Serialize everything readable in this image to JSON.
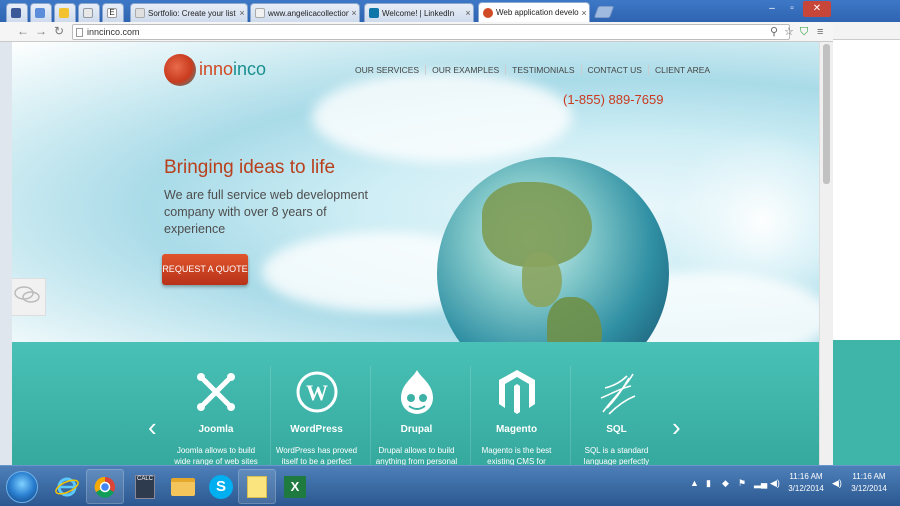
{
  "browser": {
    "tabs": [
      {
        "label": "",
        "favicon_color": "#3b5998"
      },
      {
        "label": "",
        "favicon_color": "#5b8ddb"
      },
      {
        "label": "",
        "favicon_color": "#f2c230"
      },
      {
        "label": "",
        "favicon_color": "#8f9aa5"
      },
      {
        "label": "Sortfolio: Create your list",
        "favicon_color": "#e0e0e0"
      },
      {
        "label": "www.angelicacollection.c",
        "favicon_color": "#cfcfcf"
      },
      {
        "label": "Welcome! | LinkedIn",
        "favicon_color": "#0e76a8"
      },
      {
        "label": "Web application develop",
        "favicon_color": "#d04a24"
      }
    ],
    "address": "inncinco.com"
  },
  "site": {
    "logo_text_a": "inno",
    "logo_text_b": "inco",
    "nav": [
      "OUR SERVICES",
      "OUR EXAMPLES",
      "TESTIMONIALS",
      "CONTACT US",
      "CLIENT AREA"
    ],
    "phone": "(1-855) 889-7659",
    "tagline": "Bringing ideas to life",
    "subtagline": "We are full service web development company with over 8 years of experience",
    "cta": "REQUEST A QUOTE",
    "features": [
      {
        "name": "Joomla",
        "desc": "Joomla allows to build wide range of web sites",
        "icon": "joomla-icon"
      },
      {
        "name": "WordPress",
        "desc": "WordPress has proved itself to be a perfect",
        "icon": "wordpress-icon"
      },
      {
        "name": "Drupal",
        "desc": "Drupal allows to build anything from personal",
        "icon": "drupal-icon"
      },
      {
        "name": "Magento",
        "desc": "Magento is the best existing CMS for",
        "icon": "magento-icon"
      },
      {
        "name": "SQL",
        "desc": "SQL is a standard language perfectly",
        "icon": "sql-server-icon"
      }
    ]
  },
  "taskbar": {
    "clock_time": "11:16 AM",
    "clock_date": "3/12/2014",
    "clock_time_2": "11:16 AM",
    "clock_date_2": "3/12/2014"
  },
  "colors": {
    "brand_red": "#c93b1f",
    "teal": "#45bdb2",
    "chrome_blue": "#3d78c7"
  }
}
